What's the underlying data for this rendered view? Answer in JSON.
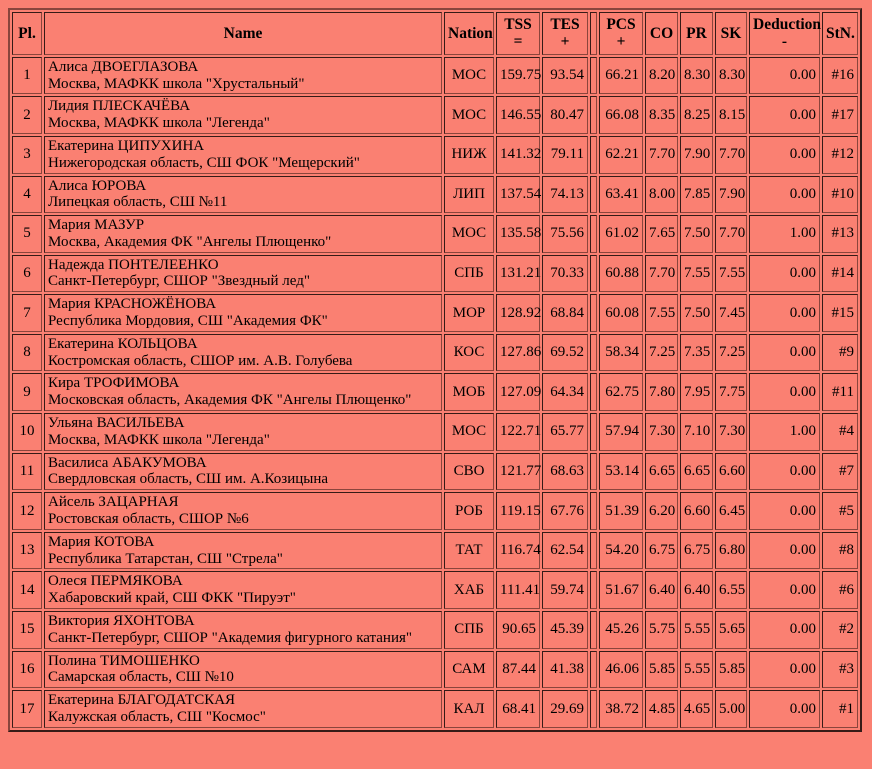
{
  "theme": {
    "background": "#fa8072",
    "border": "#8a453c",
    "text": "#000000"
  },
  "table": {
    "columns": [
      {
        "key": "pl",
        "label": "Pl.",
        "sub": ""
      },
      {
        "key": "name",
        "label": "Name",
        "sub": ""
      },
      {
        "key": "nat",
        "label": "Nation",
        "sub": ""
      },
      {
        "key": "tss",
        "label": "TSS",
        "sub": "="
      },
      {
        "key": "tes",
        "label": "TES",
        "sub": "+"
      },
      {
        "key": "gap",
        "label": "",
        "sub": ""
      },
      {
        "key": "pcs",
        "label": "PCS",
        "sub": "+"
      },
      {
        "key": "co",
        "label": "CO",
        "sub": ""
      },
      {
        "key": "pr",
        "label": "PR",
        "sub": ""
      },
      {
        "key": "sk",
        "label": "SK",
        "sub": ""
      },
      {
        "key": "ded",
        "label": "Deduction",
        "sub": "-"
      },
      {
        "key": "stn",
        "label": "StN.",
        "sub": ""
      }
    ],
    "rows": [
      {
        "pl": "1",
        "name": "Алиса ДВОЕГЛАЗОВА",
        "club": "Москва, МАФКК школа \"Хрустальный\"",
        "nat": "МОС",
        "tss": "159.75",
        "tes": "93.54",
        "pcs": "66.21",
        "co": "8.20",
        "pr": "8.30",
        "sk": "8.30",
        "ded": "0.00",
        "stn": "#16"
      },
      {
        "pl": "2",
        "name": "Лидия ПЛЕСКАЧЁВА",
        "club": "Москва, МАФКК школа \"Легенда\"",
        "nat": "МОС",
        "tss": "146.55",
        "tes": "80.47",
        "pcs": "66.08",
        "co": "8.35",
        "pr": "8.25",
        "sk": "8.15",
        "ded": "0.00",
        "stn": "#17"
      },
      {
        "pl": "3",
        "name": "Екатерина ЦИПУХИНА",
        "club": "Нижегородская область, СШ ФОК \"Мещерский\"",
        "nat": "НИЖ",
        "tss": "141.32",
        "tes": "79.11",
        "pcs": "62.21",
        "co": "7.70",
        "pr": "7.90",
        "sk": "7.70",
        "ded": "0.00",
        "stn": "#12"
      },
      {
        "pl": "4",
        "name": "Алиса ЮРОВА",
        "club": "Липецкая область, СШ №11",
        "nat": "ЛИП",
        "tss": "137.54",
        "tes": "74.13",
        "pcs": "63.41",
        "co": "8.00",
        "pr": "7.85",
        "sk": "7.90",
        "ded": "0.00",
        "stn": "#10"
      },
      {
        "pl": "5",
        "name": "Мария МАЗУР",
        "club": "Москва, Академия ФК \"Ангелы Плющенко\"",
        "nat": "МОС",
        "tss": "135.58",
        "tes": "75.56",
        "pcs": "61.02",
        "co": "7.65",
        "pr": "7.50",
        "sk": "7.70",
        "ded": "1.00",
        "stn": "#13"
      },
      {
        "pl": "6",
        "name": "Надежда ПОНТЕЛЕЕНКО",
        "club": "Санкт-Петербург, СШОР \"Звездный лед\"",
        "nat": "СПБ",
        "tss": "131.21",
        "tes": "70.33",
        "pcs": "60.88",
        "co": "7.70",
        "pr": "7.55",
        "sk": "7.55",
        "ded": "0.00",
        "stn": "#14"
      },
      {
        "pl": "7",
        "name": "Мария КРАСНОЖЁНОВА",
        "club": "Республика Мордовия, СШ \"Академия ФК\"",
        "nat": "МОР",
        "tss": "128.92",
        "tes": "68.84",
        "pcs": "60.08",
        "co": "7.55",
        "pr": "7.50",
        "sk": "7.45",
        "ded": "0.00",
        "stn": "#15"
      },
      {
        "pl": "8",
        "name": "Екатерина КОЛЬЦОВА",
        "club": "Костромская область, СШОР им. А.В. Голубева",
        "nat": "КОС",
        "tss": "127.86",
        "tes": "69.52",
        "pcs": "58.34",
        "co": "7.25",
        "pr": "7.35",
        "sk": "7.25",
        "ded": "0.00",
        "stn": "#9"
      },
      {
        "pl": "9",
        "name": "Кира ТРОФИМОВА",
        "club": "Московская область, Академия ФК \"Ангелы Плющенко\"",
        "nat": "МОБ",
        "tss": "127.09",
        "tes": "64.34",
        "pcs": "62.75",
        "co": "7.80",
        "pr": "7.95",
        "sk": "7.75",
        "ded": "0.00",
        "stn": "#11"
      },
      {
        "pl": "10",
        "name": "Ульяна ВАСИЛЬЕВА",
        "club": "Москва, МАФКК школа \"Легенда\"",
        "nat": "МОС",
        "tss": "122.71",
        "tes": "65.77",
        "pcs": "57.94",
        "co": "7.30",
        "pr": "7.10",
        "sk": "7.30",
        "ded": "1.00",
        "stn": "#4"
      },
      {
        "pl": "11",
        "name": "Василиса АБАКУМОВА",
        "club": "Свердловская область, СШ им. А.Козицына",
        "nat": "СВО",
        "tss": "121.77",
        "tes": "68.63",
        "pcs": "53.14",
        "co": "6.65",
        "pr": "6.65",
        "sk": "6.60",
        "ded": "0.00",
        "stn": "#7"
      },
      {
        "pl": "12",
        "name": "Айсель ЗАЦАРНАЯ",
        "club": "Ростовская область, СШОР №6",
        "nat": "РОБ",
        "tss": "119.15",
        "tes": "67.76",
        "pcs": "51.39",
        "co": "6.20",
        "pr": "6.60",
        "sk": "6.45",
        "ded": "0.00",
        "stn": "#5"
      },
      {
        "pl": "13",
        "name": "Мария КОТОВА",
        "club": "Республика Татарстан, СШ \"Стрела\"",
        "nat": "ТАТ",
        "tss": "116.74",
        "tes": "62.54",
        "pcs": "54.20",
        "co": "6.75",
        "pr": "6.75",
        "sk": "6.80",
        "ded": "0.00",
        "stn": "#8"
      },
      {
        "pl": "14",
        "name": "Олеся ПЕРМЯКОВА",
        "club": "Хабаровский край, СШ ФКК \"Пируэт\"",
        "nat": "ХАБ",
        "tss": "111.41",
        "tes": "59.74",
        "pcs": "51.67",
        "co": "6.40",
        "pr": "6.40",
        "sk": "6.55",
        "ded": "0.00",
        "stn": "#6"
      },
      {
        "pl": "15",
        "name": "Виктория ЯХОНТОВА",
        "club": "Санкт-Петербург, СШОР \"Академия фигурного катания\"",
        "nat": "СПБ",
        "tss": "90.65",
        "tes": "45.39",
        "pcs": "45.26",
        "co": "5.75",
        "pr": "5.55",
        "sk": "5.65",
        "ded": "0.00",
        "stn": "#2"
      },
      {
        "pl": "16",
        "name": "Полина ТИМОШЕНКО",
        "club": "Самарская область, СШ №10",
        "nat": "САМ",
        "tss": "87.44",
        "tes": "41.38",
        "pcs": "46.06",
        "co": "5.85",
        "pr": "5.55",
        "sk": "5.85",
        "ded": "0.00",
        "stn": "#3"
      },
      {
        "pl": "17",
        "name": "Екатерина БЛАГОДАТСКАЯ",
        "club": "Калужская область, СШ \"Космос\"",
        "nat": "КАЛ",
        "tss": "68.41",
        "tes": "29.69",
        "pcs": "38.72",
        "co": "4.85",
        "pr": "4.65",
        "sk": "5.00",
        "ded": "0.00",
        "stn": "#1"
      }
    ]
  }
}
